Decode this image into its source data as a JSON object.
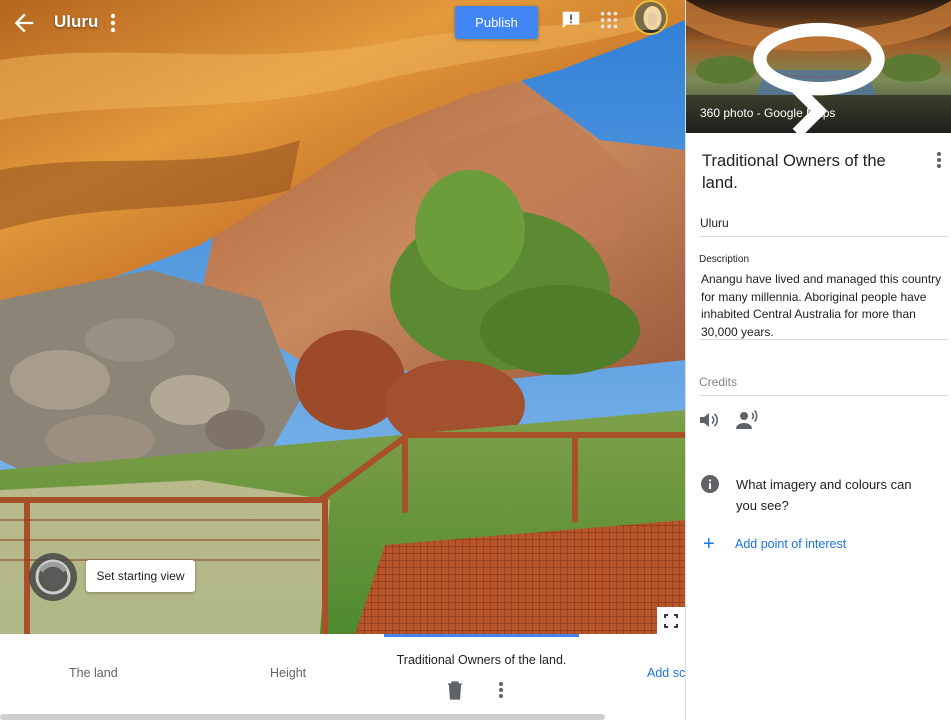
{
  "header": {
    "title": "Uluru",
    "publish_label": "Publish",
    "icons": [
      "back-arrow-icon",
      "more-vert-icon",
      "feedback-icon",
      "apps-grid-icon",
      "avatar"
    ]
  },
  "viewer": {
    "start_view_label": "Set starting view",
    "fullscreen_icon": "fullscreen-icon"
  },
  "scenes": {
    "items": [
      {
        "label": "The land"
      },
      {
        "label": "Height"
      },
      {
        "label": "Traditional Owners of the land.",
        "active": true
      }
    ],
    "add_label": "Add sc"
  },
  "panel": {
    "preview_caption": "360 photo - Google Maps",
    "poi_title": "Traditional Owners of the land.",
    "location": "Uluru",
    "description_label": "Description",
    "description": "Anangu have lived and managed this country for many millennia. Aboriginal people have inhabited Central Australia for more than 30,000 years.",
    "credits_label": "Credits",
    "question": "What imagery and colours can you see?",
    "add_poi_label": "Add point of interest"
  },
  "colors": {
    "accent": "#4285f4",
    "link": "#1a73e8",
    "rock": "#c4622d",
    "sky": "#4a90d9"
  }
}
